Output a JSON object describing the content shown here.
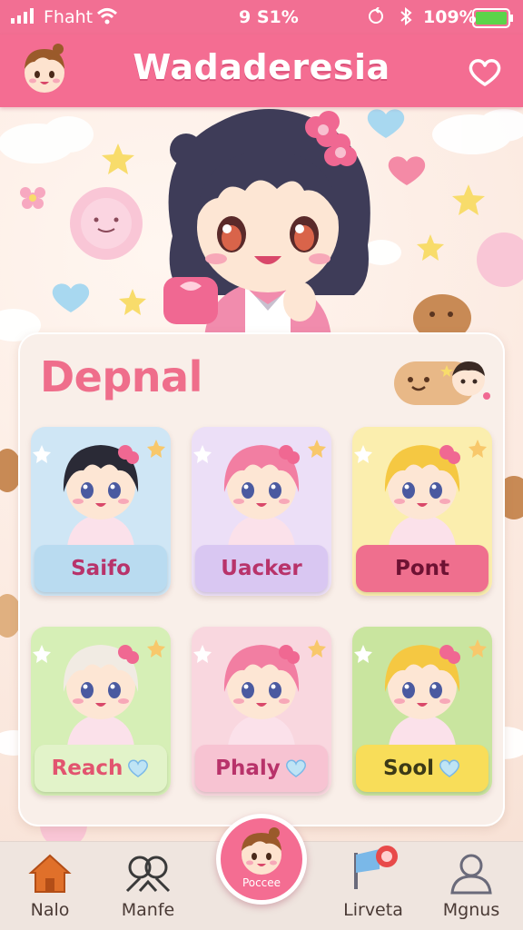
{
  "status_bar": {
    "carrier": "Fhaht",
    "time": "9 S1%",
    "battery": "109%"
  },
  "header": {
    "title": "Wadaderesia"
  },
  "panel": {
    "title": "Depnal"
  },
  "characters": [
    {
      "label": "Saifo",
      "pill_color": "#b9dbf0",
      "text_color": "#b8336a",
      "bg_color": "#cfe6f5",
      "hair_color": "#2a2a36",
      "heart": false
    },
    {
      "label": "Uacker",
      "pill_color": "#d9c7f2",
      "text_color": "#b8336a",
      "bg_color": "#ecdff7",
      "hair_color": "#f27ea2",
      "heart": false
    },
    {
      "label": "Pont",
      "pill_color": "#ef6f8e",
      "text_color": "#6d1233",
      "bg_color": "#fbeeae",
      "hair_color": "#f5c842",
      "heart": false
    },
    {
      "label": "Reach",
      "pill_color": "#e2f3c9",
      "text_color": "#e2546f",
      "bg_color": "#d6efb6",
      "hair_color": "#f1ebe3",
      "heart": true
    },
    {
      "label": "Phaly",
      "pill_color": "#f7c3d2",
      "text_color": "#b8336a",
      "bg_color": "#f9d7df",
      "hair_color": "#f27ea2",
      "heart": true
    },
    {
      "label": "Sool",
      "pill_color": "#f8dd59",
      "text_color": "#3c3a17",
      "bg_color": "#c9e59f",
      "hair_color": "#f5c842",
      "heart": true
    }
  ],
  "nav": {
    "items": [
      {
        "label": "Nalo",
        "icon": "home-icon"
      },
      {
        "label": "Manfe",
        "icon": "group-icon"
      },
      {
        "label": "Lirveta",
        "icon": "flag-icon"
      },
      {
        "label": "Mgnus",
        "icon": "user-icon"
      }
    ],
    "center_label": "Poccee"
  },
  "colors": {
    "brand_pink": "#f46d92",
    "panel_title": "#ef6e8b"
  }
}
